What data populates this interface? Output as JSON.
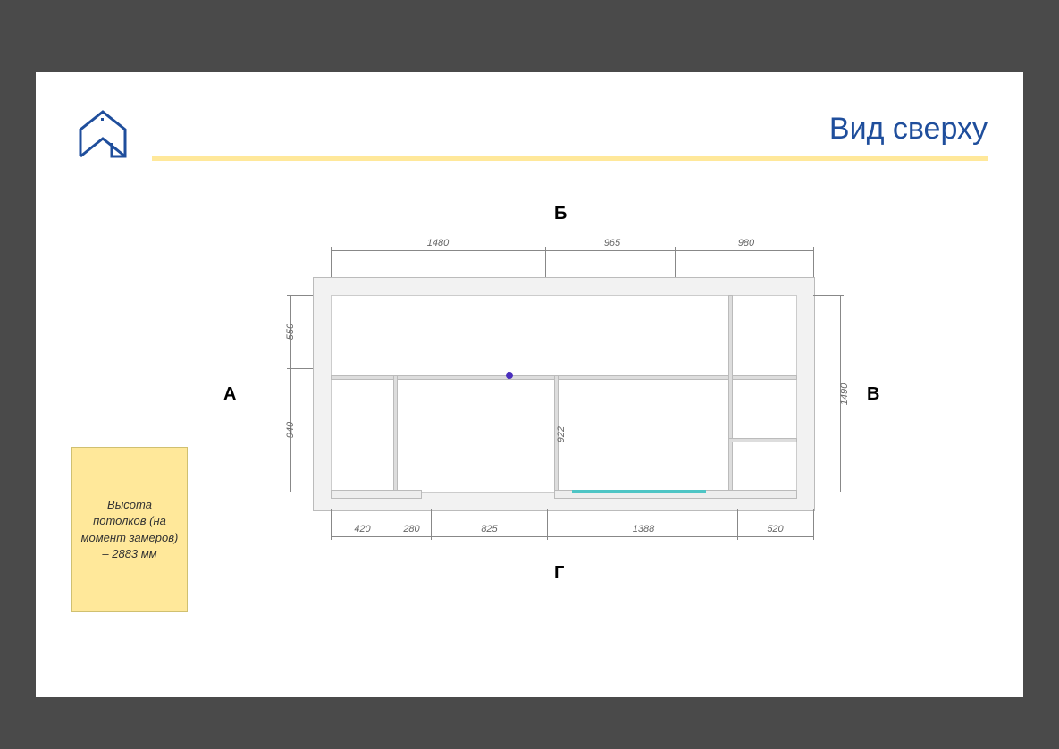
{
  "title": "Вид сверху",
  "note": "Высота потолков (на момент замеров) – 2883 мм",
  "walls": {
    "A": "А",
    "B": "Б",
    "V": "В",
    "G": "Г"
  },
  "dimensions": {
    "top": [
      "1480",
      "965",
      "980"
    ],
    "bottom": [
      "420",
      "280",
      "825",
      "1388",
      "520"
    ],
    "left": [
      "550",
      "940"
    ],
    "right": [
      "1490"
    ]
  }
}
